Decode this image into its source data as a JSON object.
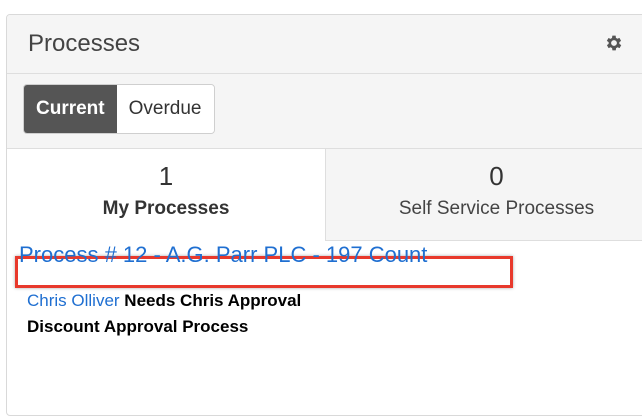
{
  "header": {
    "title": "Processes",
    "settings_icon": "gear-icon"
  },
  "toolbar": {
    "filters": [
      {
        "label": "Current",
        "active": true
      },
      {
        "label": "Overdue",
        "active": false
      }
    ]
  },
  "tabs": [
    {
      "count": "1",
      "label": "My Processes",
      "active": true
    },
    {
      "count": "0",
      "label": "Self Service Processes",
      "active": false
    }
  ],
  "process_item": {
    "title": "Process # 12 - A.G. Parr PLC - 197 Count",
    "user": "Chris Olliver",
    "status": "Needs Chris Approval",
    "definition": "Discount Approval Process",
    "highlight_color": "#e8392c"
  },
  "colors": {
    "link": "#1f6fd1",
    "active_button": "#555555"
  }
}
